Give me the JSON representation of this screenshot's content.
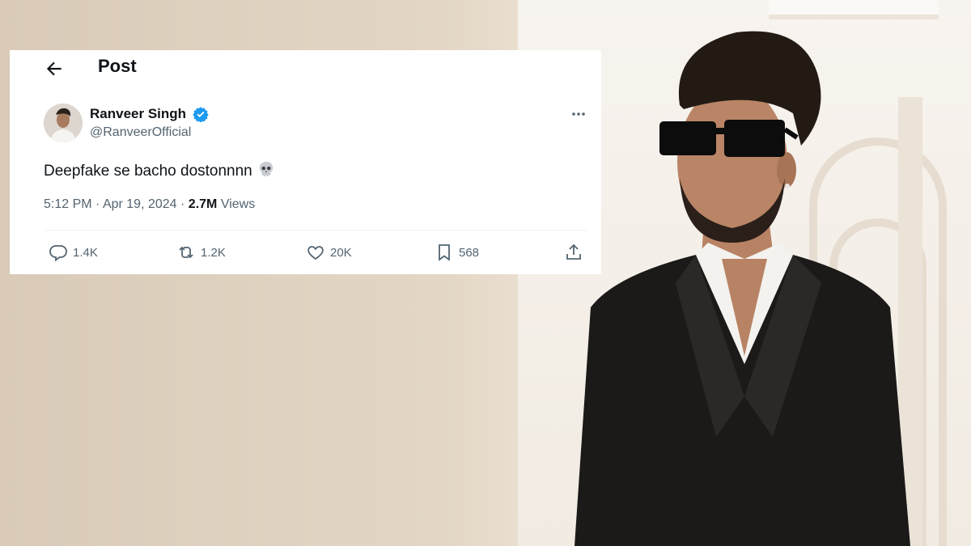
{
  "post": {
    "header_title": "Post",
    "author_name": "Ranveer Singh",
    "author_handle": "@RanveerOfficial",
    "text": "Deepfake se bacho dostonnnn",
    "time": "5:12 PM",
    "date": "Apr 19, 2024",
    "views_count": "2.7M",
    "views_label": "Views",
    "replies": "1.4K",
    "reposts": "1.2K",
    "likes": "20K",
    "bookmarks": "568"
  },
  "icons": [
    "back-arrow-icon",
    "verified-badge-icon",
    "more-icon",
    "skull-emoji-icon",
    "reply-icon",
    "repost-icon",
    "like-icon",
    "bookmark-icon",
    "share-icon"
  ],
  "colors": {
    "verified": "#1d9bf0",
    "text": "#0f1419",
    "secondary": "#536471"
  }
}
